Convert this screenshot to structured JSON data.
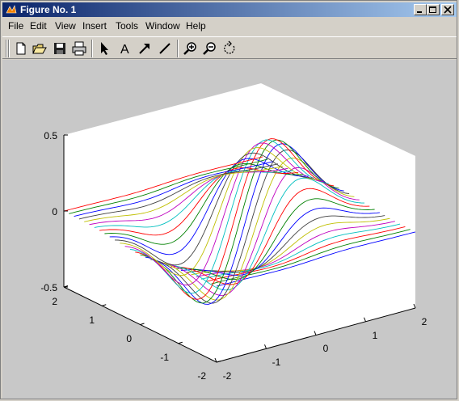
{
  "window": {
    "title": "Figure No. 1"
  },
  "menu": [
    "File",
    "Edit",
    "View",
    "Insert",
    "Tools",
    "Window",
    "Help"
  ],
  "toolbar": {
    "tools": [
      "new-figure",
      "open-file",
      "save",
      "print",
      "select-arrow",
      "insert-text",
      "insert-arrow",
      "insert-line",
      "zoom-in",
      "zoom-out",
      "rotate-3d"
    ]
  },
  "chart_data": {
    "type": "surface-mesh-3d",
    "z_ticks": [
      "0.5",
      "0",
      "-0.5"
    ],
    "x_ticks": [
      "2",
      "1",
      "0",
      "-1",
      "-2"
    ],
    "y_ticks": [
      "-2",
      "-1",
      "0",
      "1",
      "2"
    ],
    "xlim": [
      -2,
      2
    ],
    "ylim": [
      -2,
      2
    ],
    "zlim": [
      -0.5,
      0.5
    ],
    "line_colors": [
      "#0000ff",
      "#008000",
      "#ff0000",
      "#00bfbf",
      "#bf00bf",
      "#bfbf00",
      "#404040"
    ],
    "grid": false
  }
}
